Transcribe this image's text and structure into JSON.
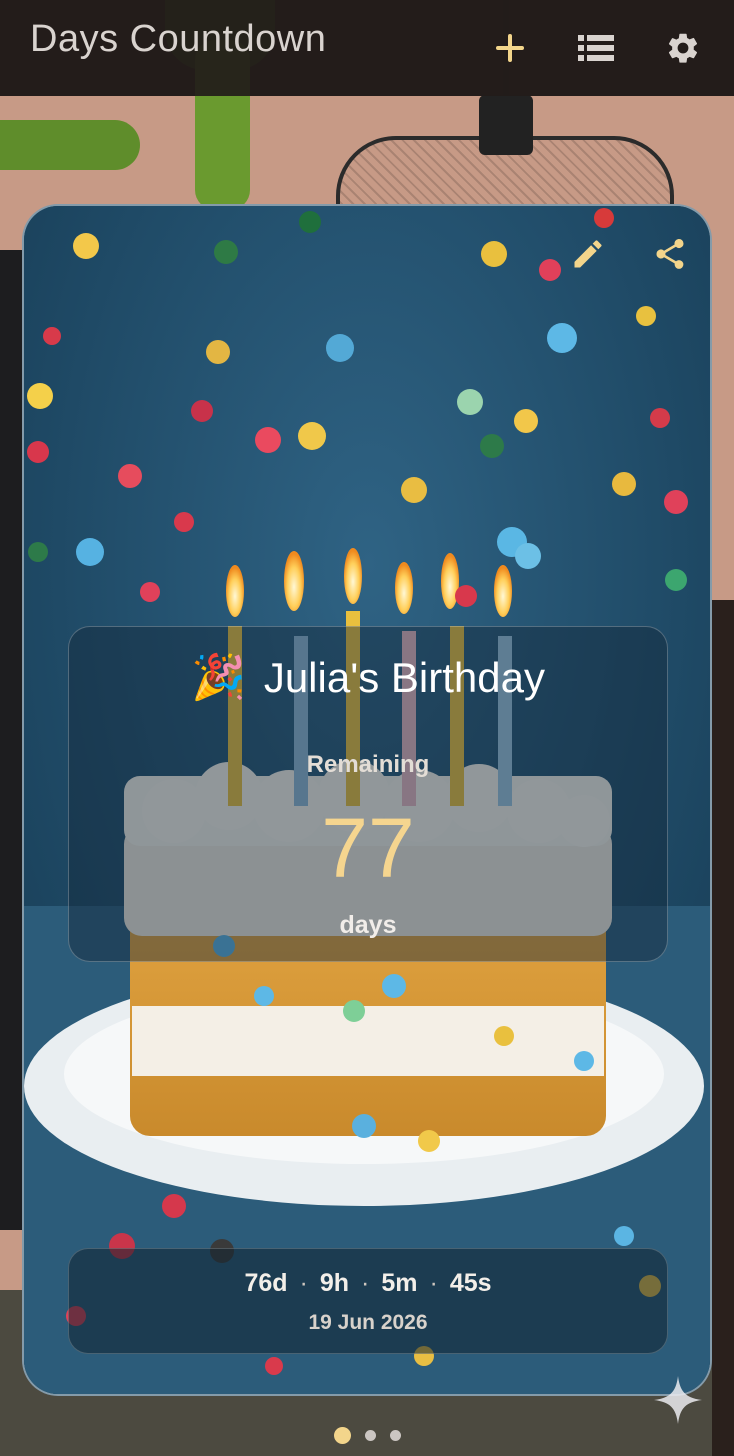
{
  "app": {
    "title": "Days Countdown"
  },
  "toolbar": {
    "add_icon": "plus-icon",
    "list_icon": "list-icon",
    "settings_icon": "gear-icon"
  },
  "card": {
    "edit_icon": "pencil-icon",
    "share_icon": "share-icon",
    "event_emoji": "🎉",
    "event_name": "Julia's Birthday",
    "remaining_label": "Remaining",
    "days_value": "77",
    "days_unit": "days",
    "countdown": {
      "days": "76d",
      "hours": "9h",
      "minutes": "5m",
      "seconds": "45s",
      "separator": "·"
    },
    "target_date": "19 Jun 2026"
  },
  "pager": {
    "pages": 3,
    "active_index": 0
  },
  "colors": {
    "accent": "#f3d58b",
    "topbar": "#221c1a",
    "card_bg": "#1f4a64"
  }
}
